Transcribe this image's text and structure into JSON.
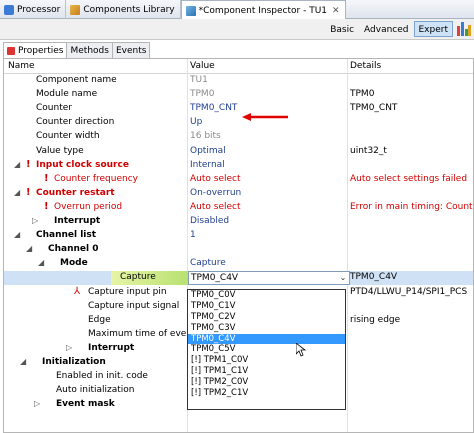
{
  "tabs": [
    {
      "label": "Processor",
      "icon": "processor-icon",
      "close": false
    },
    {
      "label": "Components Library",
      "icon": "library-icon",
      "close": false
    },
    {
      "label": "*Component Inspector - TU1",
      "icon": "inspector-icon",
      "close": true
    }
  ],
  "modes": [
    "Basic",
    "Advanced",
    "Expert"
  ],
  "active_mode": "Expert",
  "inner_tabs": [
    "Properties",
    "Methods",
    "Events"
  ],
  "columns": {
    "name": "Name",
    "value": "Value",
    "details": "Details"
  },
  "rows": [
    {
      "name": "Component name",
      "value": "TU1",
      "details": "",
      "indent": 32,
      "vstyle": "grey"
    },
    {
      "name": "Module name",
      "value": "TPM0",
      "details": "TPM0",
      "indent": 32,
      "vstyle": "grey"
    },
    {
      "name": "Counter",
      "value": "TPM0_CNT",
      "details": "TPM0_CNT",
      "indent": 32
    },
    {
      "name": "Counter direction",
      "value": "Up",
      "details": "",
      "indent": 32
    },
    {
      "name": "Counter width",
      "value": "16 bits",
      "details": "",
      "indent": 32,
      "vstyle": "grey"
    },
    {
      "name": "Value type",
      "value": "Optimal",
      "details": "uint32_t",
      "indent": 32
    },
    {
      "name": "Input clock source",
      "value": "Internal",
      "details": "",
      "indent": 32,
      "expand": "open",
      "bang": true,
      "nstyle": "red bold"
    },
    {
      "name": "Counter frequency",
      "value": "Auto select",
      "details": "Auto select settings failed",
      "indent": 50,
      "bang": true,
      "nstyle": "red",
      "vstyle": "red",
      "dstyle": "red"
    },
    {
      "name": "Counter restart",
      "value": "On-overrun",
      "details": "",
      "indent": 32,
      "expand": "open",
      "bang": true,
      "nstyle": "red bold"
    },
    {
      "name": "Overrun period",
      "value": "Auto select",
      "details": "Error in main timing: Counter",
      "indent": 50,
      "bang": true,
      "nstyle": "red",
      "vstyle": "red",
      "dstyle": "red"
    },
    {
      "name": "Interrupt",
      "value": "Disabled",
      "details": "",
      "indent": 50,
      "expand": "closed",
      "nstyle": "bold"
    },
    {
      "name": "Channel list",
      "value": "1",
      "details": "",
      "indent": 32,
      "expand": "open",
      "nstyle": "bold"
    },
    {
      "name": "Channel 0",
      "value": "",
      "details": "",
      "indent": 44,
      "expand": "open",
      "nstyle": "bold"
    },
    {
      "name": "Mode",
      "value": "Capture",
      "details": "",
      "indent": 56,
      "expand": "open",
      "nstyle": "bold"
    },
    {
      "name": "Capture",
      "value": "TPM0_C4V",
      "details": "TPM0_C4V",
      "indent": 116,
      "selected": true
    },
    {
      "name": "Capture input pin",
      "value": "",
      "details": "PTD4/LLWU_P14/SPI1_PCS",
      "indent": 84,
      "pin": true
    },
    {
      "name": "Capture input signal",
      "value": "",
      "details": "",
      "indent": 84
    },
    {
      "name": "Edge",
      "value": "",
      "details": "rising edge",
      "indent": 84
    },
    {
      "name": "Maximum time of event",
      "value": "",
      "details": "",
      "indent": 84
    },
    {
      "name": "Interrupt",
      "value": "",
      "details": "",
      "indent": 84,
      "expand": "closed",
      "nstyle": "bold"
    },
    {
      "name": "Initialization",
      "value": "",
      "details": "",
      "indent": 38,
      "expand": "open",
      "nstyle": "bold"
    },
    {
      "name": "Enabled in init. code",
      "value": "",
      "details": "",
      "indent": 52
    },
    {
      "name": "Auto initialization",
      "value": "",
      "details": "",
      "indent": 52
    },
    {
      "name": "Event mask",
      "value": "",
      "details": "",
      "indent": 52,
      "expand": "closed",
      "nstyle": "bold"
    }
  ],
  "dropdown": {
    "options": [
      "TPM0_C0V",
      "TPM0_C1V",
      "TPM0_C2V",
      "TPM0_C3V",
      "TPM0_C4V",
      "TPM0_C5V",
      "[!] TPM1_C0V",
      "[!] TPM1_C1V",
      "[!] TPM2_C0V",
      "[!] TPM2_C1V"
    ],
    "highlighted": "TPM0_C4V"
  },
  "colors": {
    "selection": "#3399ff",
    "error": "#d10000",
    "value_text": "#1f3f8f",
    "annotation_arrow": "#e00000"
  }
}
